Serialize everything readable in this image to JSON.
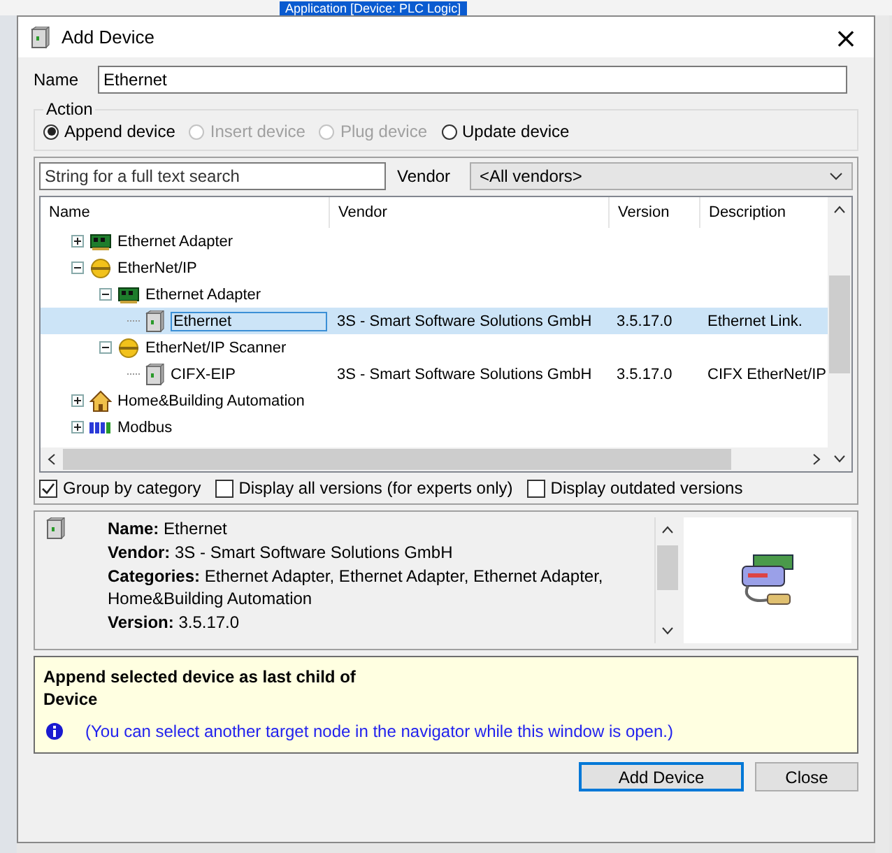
{
  "background_toolbar": {
    "selected_item": "Application [Device: PLC Logic]"
  },
  "window": {
    "title": "Add Device",
    "close": "×"
  },
  "name_field": {
    "label": "Name",
    "value": "Ethernet"
  },
  "action": {
    "title": "Action",
    "options": [
      {
        "label": "Append device",
        "selected": true,
        "disabled": false
      },
      {
        "label": "Insert device",
        "selected": false,
        "disabled": true
      },
      {
        "label": "Plug device",
        "selected": false,
        "disabled": true
      },
      {
        "label": "Update device",
        "selected": false,
        "disabled": false
      }
    ]
  },
  "search": {
    "placeholder": "String for a full text search"
  },
  "vendor_filter": {
    "label": "Vendor",
    "value": "<All vendors>"
  },
  "table": {
    "columns": [
      "Name",
      "Vendor",
      "Version",
      "Description"
    ],
    "nodes": [
      {
        "name": "Ethernet Adapter",
        "kind": "adapter",
        "expanded": false,
        "selected": false
      },
      {
        "name": "EtherNet/IP",
        "kind": "bus",
        "expanded": true,
        "selected": false,
        "children": [
          {
            "name": "Ethernet Adapter",
            "kind": "adapter",
            "expanded": true,
            "selected": false,
            "children": [
              {
                "name": "Ethernet",
                "kind": "device",
                "selected": true,
                "vendor": "3S - Smart Software Solutions GmbH",
                "version": "3.5.17.0",
                "description": "Ethernet Link."
              }
            ]
          },
          {
            "name": "EtherNet/IP Scanner",
            "kind": "bus",
            "expanded": true,
            "selected": false,
            "children": [
              {
                "name": "CIFX-EIP",
                "kind": "device",
                "selected": false,
                "vendor": "3S - Smart Software Solutions GmbH",
                "version": "3.5.17.0",
                "description": "CIFX EtherNet/IP"
              }
            ]
          }
        ]
      },
      {
        "name": "Home&Building Automation",
        "kind": "home",
        "expanded": false,
        "selected": false
      },
      {
        "name": "Modbus",
        "kind": "modbus",
        "expanded": false,
        "selected": false
      }
    ]
  },
  "options": [
    {
      "label": "Group by category",
      "checked": true
    },
    {
      "label": "Display all versions (for experts only)",
      "checked": false
    },
    {
      "label": "Display outdated versions",
      "checked": false
    }
  ],
  "details": {
    "lines": [
      "**Name:** Ethernet",
      "**Vendor:** 3S - Smart Software Solutions GmbH",
      "**Categories:** Ethernet Adapter, Ethernet Adapter, Ethernet Adapter, Home&Building Automation",
      "**Version:** 3.5.17.0"
    ]
  },
  "info": {
    "title_lines": [
      "Append selected device as last child of",
      "Device"
    ],
    "note": "(You can select another target node in the navigator while this window is open.)"
  },
  "buttons": [
    "Add Device",
    "Close"
  ]
}
